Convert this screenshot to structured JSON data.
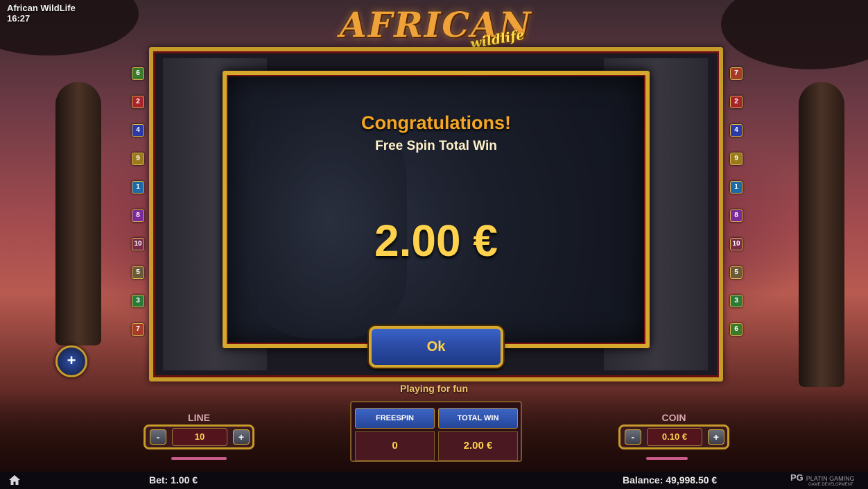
{
  "window": {
    "title": "African WildLife",
    "time": "16:27"
  },
  "logo": {
    "main": "AFRICAN",
    "sub": "wildlife"
  },
  "line_markers_left": [
    {
      "label": "6",
      "color": "#3a7a2c"
    },
    {
      "label": "2",
      "color": "#a8242a"
    },
    {
      "label": "4",
      "color": "#2c3aa8"
    },
    {
      "label": "9",
      "color": "#9a7a1c"
    },
    {
      "label": "1",
      "color": "#1e6aa8"
    },
    {
      "label": "8",
      "color": "#7a2a9a"
    },
    {
      "label": "10",
      "color": "#7a2a4a"
    },
    {
      "label": "5",
      "color": "#6a5a3a"
    },
    {
      "label": "3",
      "color": "#2a7a3a"
    },
    {
      "label": "7",
      "color": "#a83a2a"
    }
  ],
  "line_markers_right": [
    {
      "label": "7",
      "color": "#a83a2a"
    },
    {
      "label": "2",
      "color": "#a8242a"
    },
    {
      "label": "4",
      "color": "#2c3aa8"
    },
    {
      "label": "9",
      "color": "#9a7a1c"
    },
    {
      "label": "1",
      "color": "#1e6aa8"
    },
    {
      "label": "8",
      "color": "#7a2a9a"
    },
    {
      "label": "10",
      "color": "#7a2a4a"
    },
    {
      "label": "5",
      "color": "#6a5a3a"
    },
    {
      "label": "3",
      "color": "#2a7a3a"
    },
    {
      "label": "6",
      "color": "#3a7a2c"
    }
  ],
  "dialog": {
    "heading": "Congratulations!",
    "subtitle": "Free Spin Total Win",
    "amount": "2.00 €",
    "ok_label": "Ok"
  },
  "status": {
    "playing_for_fun": "Playing for fun"
  },
  "line_control": {
    "label": "LINE",
    "value": "10",
    "minus": "-",
    "plus": "+"
  },
  "coin_control": {
    "label": "COIN",
    "value": "0.10 €",
    "minus": "-",
    "plus": "+"
  },
  "info": {
    "freespin_label": "FREESPIN",
    "freespin_value": "0",
    "total_win_label": "TOTAL WIN",
    "total_win_value": "2.00 €"
  },
  "bottom": {
    "bet": "Bet: 1.00 €",
    "balance": "Balance: 49,998.50 €",
    "brand_line1": "PLATIN GAMING",
    "brand_line2": "GAME DEVELOPMENT"
  },
  "icons": {
    "home": "home-icon",
    "add": "plus-icon"
  },
  "colors": {
    "accent_gold": "#d6a82e",
    "win_yellow": "#ffd24d",
    "button_blue": "#2a4aa3"
  }
}
